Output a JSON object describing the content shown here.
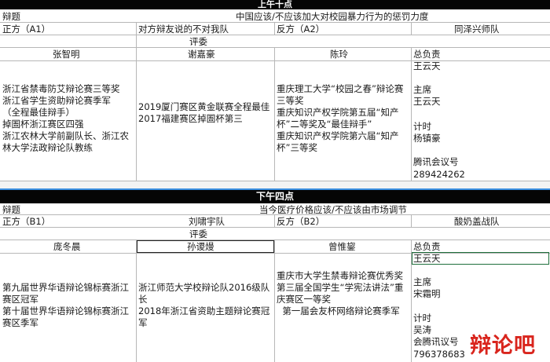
{
  "morning": {
    "banner": "上午十点",
    "topic_label": "辩题",
    "topic": "中国应该/不应该加大对校园暴力行为的惩罚力度",
    "pro_label": "正方（A1）",
    "pro_note": "对方辩友说的不对我队",
    "con_label": "反方（A2）",
    "con_team": "同泽兴师队",
    "judges_label": "评委",
    "judges": [
      {
        "name": "张智明",
        "creds": "浙江省禁毒防艾辩论赛三等奖\n浙江省学生资助辩论赛季军\n（全程最佳辩手）\n掉圄杯浙江赛区四强\n浙江农林大学前副队长、浙江农林大学法政辩论队教练"
      },
      {
        "name": "谢嘉豪",
        "creds": "2019厦门赛区黄金联赛全程最佳\n2017福建赛区掉圄杯第三"
      },
      {
        "name": "陈玲",
        "creds": "重庆理工大学“校园之春”辩论赛三等奖\n重庆知识产权学院第五届“知产杯”二等奖及“最佳辩手”\n重庆知识产权学院第六届“知产杯”三等奖"
      }
    ],
    "staff": [
      "总负责",
      "王云天",
      "",
      "主席",
      "王云天",
      "",
      "计时",
      "杨镇豪",
      "",
      "腾讯会议号",
      "289424262"
    ]
  },
  "afternoon": {
    "banner": "下午四点",
    "topic_label": "辩题",
    "topic": "当今医疗价格应该/不应该由市场调节",
    "pro_label": "正方（B1）",
    "pro_team": "刘啸宇队",
    "con_label": "反方（B2）",
    "con_team": "酸奶盖战队",
    "judges_label": "评委",
    "judges": [
      {
        "name": "庞冬晨",
        "creds": "第九届世界华语辩论锦标赛浙江赛区冠军\n第十届世界华语辩论锦标赛浙江赛区季军"
      },
      {
        "name": "孙谡熳",
        "creds": "浙江师范大学校辩论队2016级队长\n2018年浙江省资助主题辩论赛冠军"
      },
      {
        "name": "曾惟鋆",
        "creds": "重庆市大学生禁毒辩论赛优秀奖\n第三届全国学生“学宪法讲法”重庆赛区一等奖\n  第一届会友杯网络辩论赛季军"
      }
    ],
    "staff": [
      "总负责",
      "王云天",
      "",
      "主席",
      "宋霜明",
      "",
      "计时",
      "吴涛",
      "会腾讯议号",
      "796378683"
    ]
  },
  "watermark": "辩论吧"
}
